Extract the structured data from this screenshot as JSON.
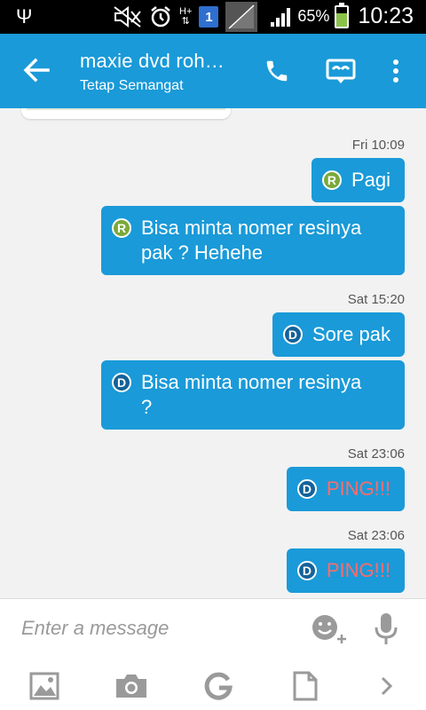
{
  "status_bar": {
    "usb_icon": "usb-icon",
    "sim_number": "1",
    "network_type": "H+",
    "battery_percent": "65%",
    "battery_level": 0.65,
    "time": "10:23"
  },
  "header": {
    "title": "maxie dvd roh…",
    "subtitle": "Tetap Semangat",
    "back_icon": "back-arrow-icon",
    "call_icon": "phone-icon",
    "incognito_icon": "mask-icon",
    "menu_icon": "more-vert-icon"
  },
  "messages": [
    {
      "timestamp": "Fri 10:09"
    },
    {
      "avatar": "R",
      "text": "Pagi"
    },
    {
      "avatar": "R",
      "text_line1": "Bisa minta nomer resinya",
      "text_line2": "pak ? Hehehe"
    },
    {
      "timestamp": "Sat 15:20"
    },
    {
      "avatar": "D",
      "text": "Sore pak"
    },
    {
      "avatar": "D",
      "text_line1": "Bisa minta nomer resinya",
      "text_line2": "?"
    },
    {
      "timestamp": "Sat 23:06"
    },
    {
      "avatar": "D",
      "text": "PING!!!"
    },
    {
      "timestamp": "Sat 23:06"
    },
    {
      "avatar": "D",
      "text": "PING!!!"
    }
  ],
  "composer": {
    "placeholder": "Enter a message",
    "emoji_icon": "emoji-add-icon",
    "mic_icon": "mic-icon",
    "toolbar": [
      "gallery-icon",
      "camera-icon",
      "google-icon",
      "file-icon",
      "chevron-right-icon"
    ]
  },
  "colors": {
    "accent": "#1a9ad8",
    "ping": "#ff6b6b",
    "avatar_r": "#7aa93a",
    "avatar_d": "#14629a"
  }
}
